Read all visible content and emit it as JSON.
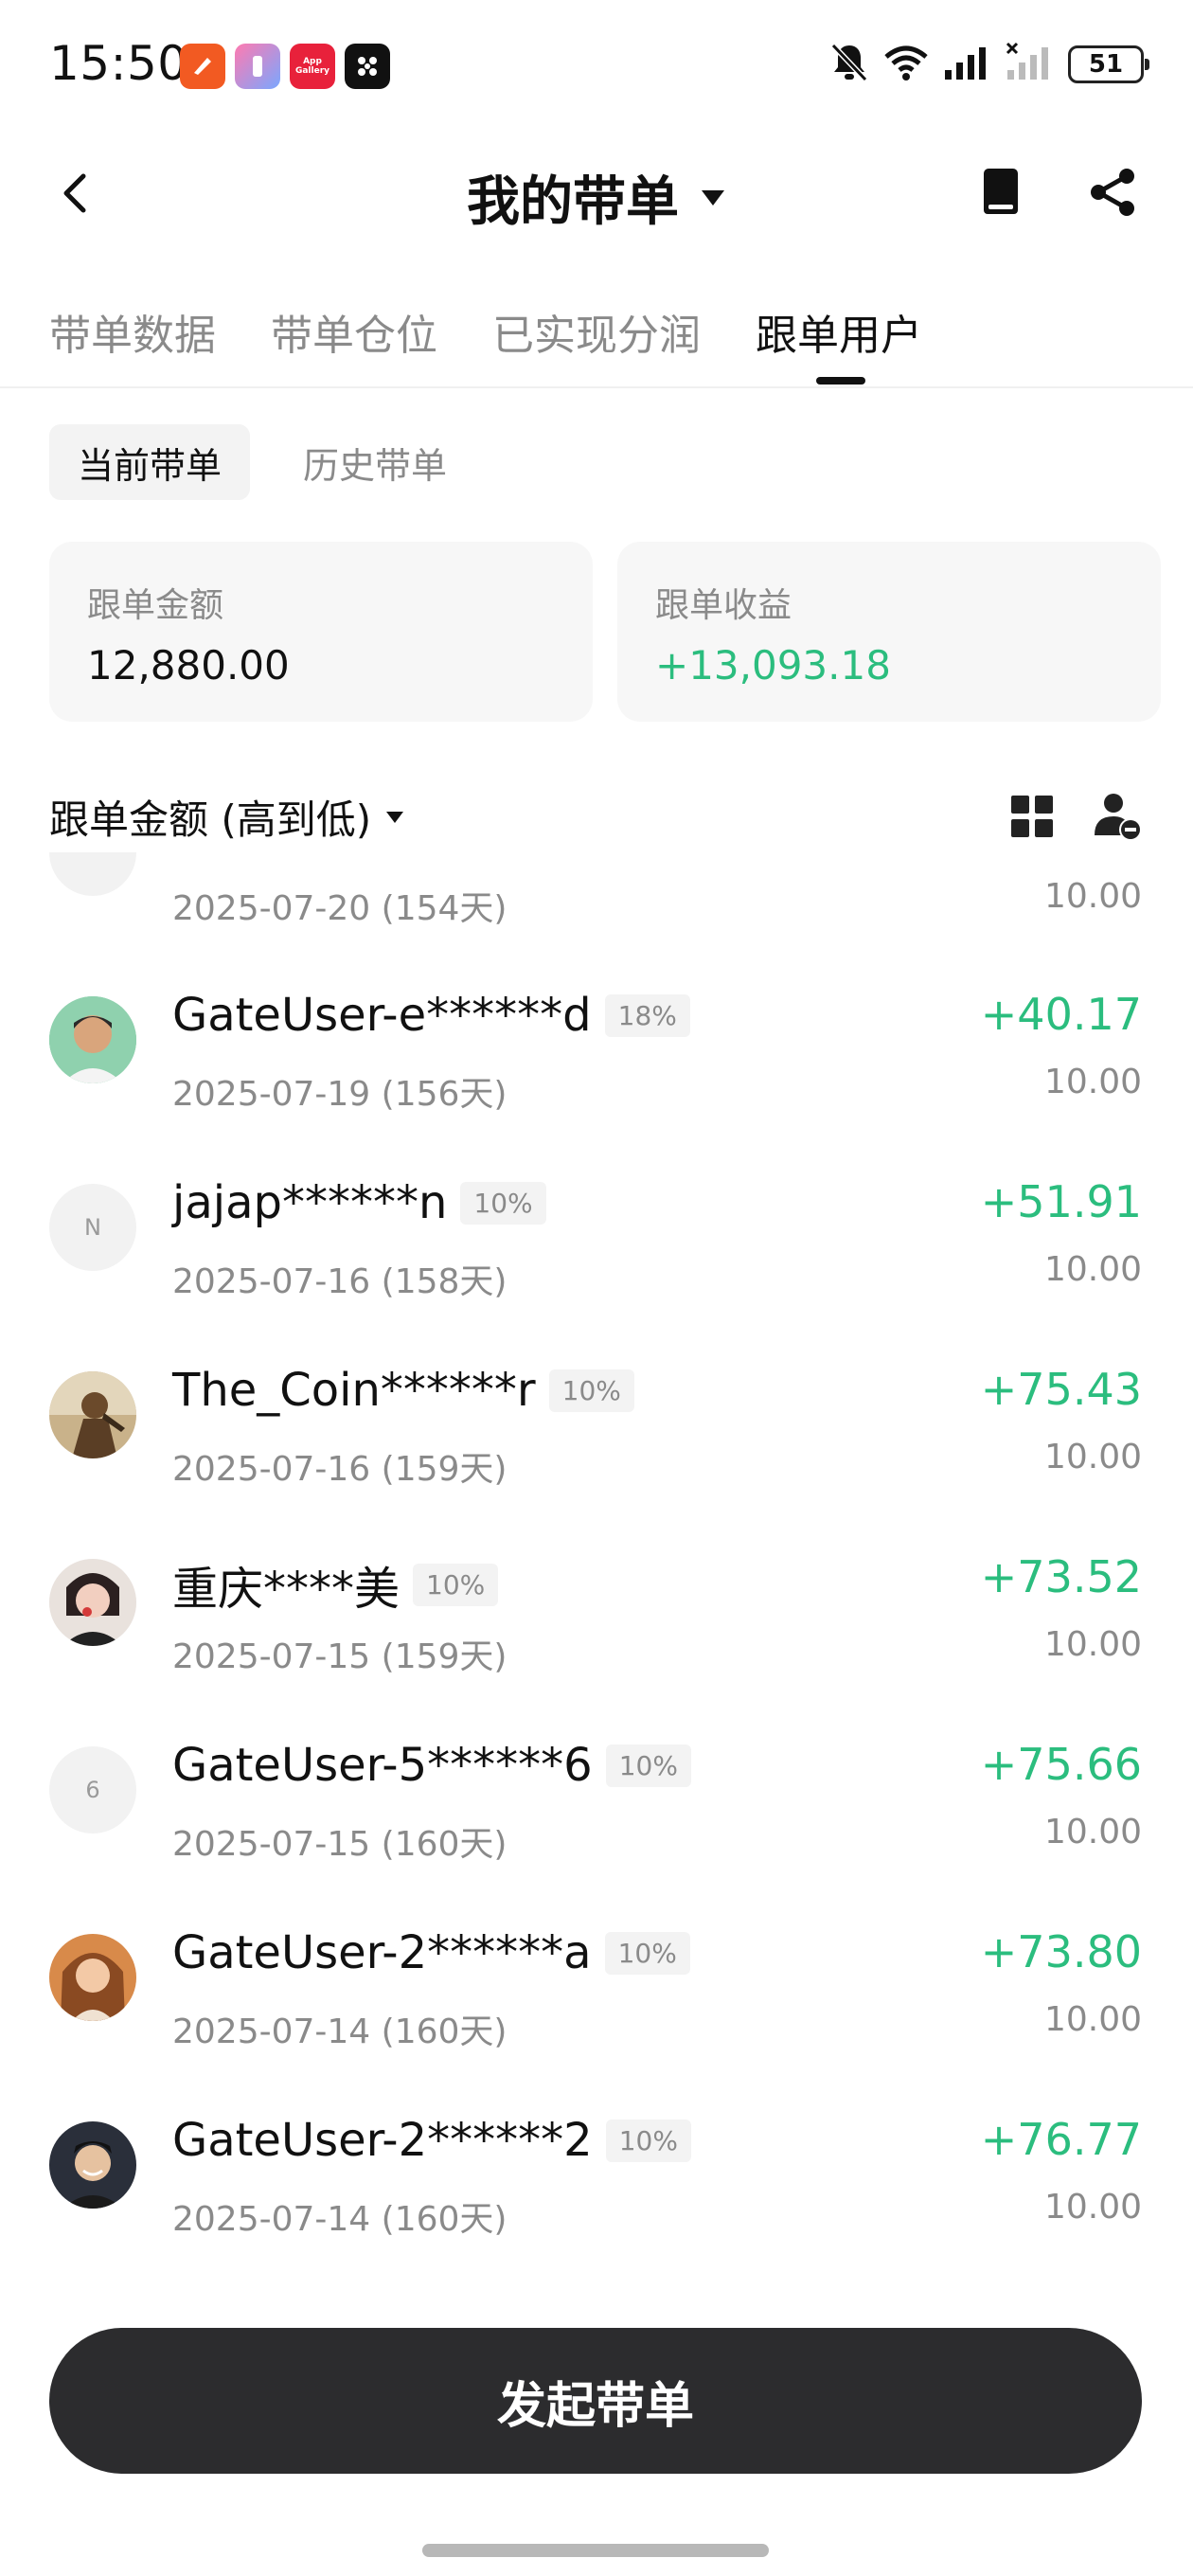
{
  "status_bar": {
    "time": "15:50",
    "battery": "51",
    "app_gallery_label": "App Gallery"
  },
  "header": {
    "title": "我的带单"
  },
  "tabs": [
    {
      "label": "带单数据",
      "active": false
    },
    {
      "label": "带单仓位",
      "active": false
    },
    {
      "label": "已实现分润",
      "active": false
    },
    {
      "label": "跟单用户",
      "active": true
    }
  ],
  "subtabs": [
    {
      "label": "当前带单",
      "active": true
    },
    {
      "label": "历史带单",
      "active": false
    }
  ],
  "summary": {
    "amount_label": "跟单金额",
    "amount_value": "12,880.00",
    "profit_label": "跟单收益",
    "profit_value": "+13,093.18"
  },
  "sort": {
    "label": "跟单金额 (高到低)"
  },
  "followers": [
    {
      "name": "",
      "badge": "",
      "date": "2025-07-20 (154天)",
      "profit": "",
      "amount": "10.00",
      "avatar": "blank",
      "initial": ""
    },
    {
      "name": "GateUser-e******d",
      "badge": "18%",
      "date": "2025-07-19 (156天)",
      "profit": "+40.17",
      "amount": "10.00",
      "avatar": "photo",
      "initial": ""
    },
    {
      "name": "jajap******n",
      "badge": "10%",
      "date": "2025-07-16 (158天)",
      "profit": "+51.91",
      "amount": "10.00",
      "avatar": "letter",
      "initial": "N"
    },
    {
      "name": "The_Coin******r",
      "badge": "10%",
      "date": "2025-07-16 (159天)",
      "profit": "+75.43",
      "amount": "10.00",
      "avatar": "photo",
      "initial": ""
    },
    {
      "name": "重庆****美",
      "badge": "10%",
      "date": "2025-07-15 (159天)",
      "profit": "+73.52",
      "amount": "10.00",
      "avatar": "photo",
      "initial": ""
    },
    {
      "name": "GateUser-5******6",
      "badge": "10%",
      "date": "2025-07-15 (160天)",
      "profit": "+75.66",
      "amount": "10.00",
      "avatar": "letter",
      "initial": "6"
    },
    {
      "name": "GateUser-2******a",
      "badge": "10%",
      "date": "2025-07-14 (160天)",
      "profit": "+73.80",
      "amount": "10.00",
      "avatar": "photo",
      "initial": ""
    },
    {
      "name": "GateUser-2******2",
      "badge": "10%",
      "date": "2025-07-14 (160天)",
      "profit": "+76.77",
      "amount": "10.00",
      "avatar": "photo",
      "initial": ""
    }
  ],
  "bottom": {
    "launch_label": "发起带单"
  },
  "colors": {
    "profit_green": "#2bbd7e",
    "button_dark": "#2c2c2e"
  }
}
